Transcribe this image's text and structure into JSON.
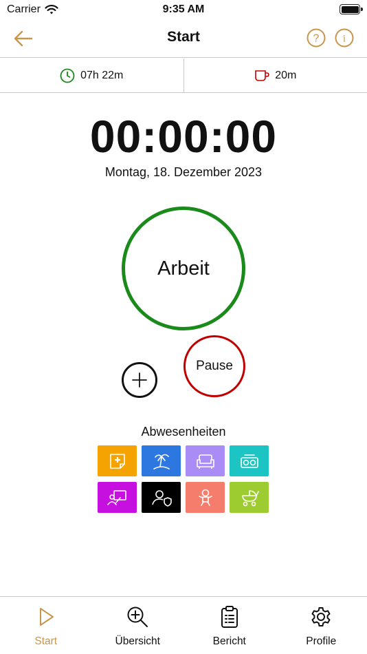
{
  "status_bar": {
    "carrier": "Carrier",
    "time": "9:35 AM"
  },
  "header": {
    "title": "Start"
  },
  "summary": {
    "work_time": "07h 22m",
    "break_time": "20m"
  },
  "timer": {
    "value": "00:00:00",
    "date": "Montag, 18. Dezember 2023"
  },
  "actions": {
    "work_label": "Arbeit",
    "pause_label": "Pause"
  },
  "absences": {
    "title": "Abwesenheiten",
    "items": [
      {
        "icon": "sick-note-icon",
        "color": "#f5a300"
      },
      {
        "icon": "vacation-icon",
        "color": "#2c77e0"
      },
      {
        "icon": "sofa-icon",
        "color": "#a98cf5"
      },
      {
        "icon": "radio-icon",
        "color": "#1cc4c4"
      },
      {
        "icon": "training-icon",
        "color": "#c510e0"
      },
      {
        "icon": "user-shield-icon",
        "color": "#000000"
      },
      {
        "icon": "baby-icon",
        "color": "#f47d6c"
      },
      {
        "icon": "stroller-icon",
        "color": "#9ccc2f"
      }
    ]
  },
  "colors": {
    "accent": "#c8964a",
    "work": "#1a8a1a",
    "pause": "#c00000"
  },
  "tabs": [
    {
      "label": "Start",
      "icon": "play-icon",
      "active": true
    },
    {
      "label": "Übersicht",
      "icon": "zoom-in-icon",
      "active": false
    },
    {
      "label": "Bericht",
      "icon": "clipboard-icon",
      "active": false
    },
    {
      "label": "Profile",
      "icon": "gear-icon",
      "active": false
    }
  ]
}
